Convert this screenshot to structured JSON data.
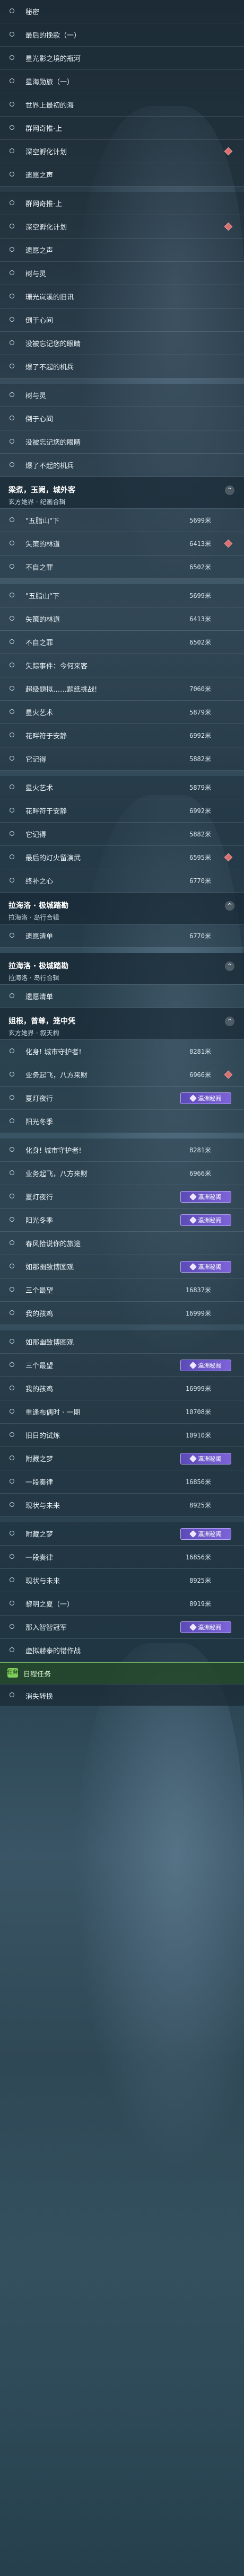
{
  "colors": {
    "accent_badge": "#6b55c8",
    "diamond": "#d87070",
    "bottom_bar": "#7fcf5a"
  },
  "badge_label": "瀛洲秘阁",
  "blocks": [
    {
      "kind": "rows",
      "rows": [
        {
          "label": "秘密"
        },
        {
          "label": "最后的挽歌（一）"
        },
        {
          "label": "星光影之境的瓶河"
        },
        {
          "label": "星海勋旅（一）"
        },
        {
          "label": "世界上最初的海"
        },
        {
          "label": "群网奇推·上"
        },
        {
          "label": "深空孵化计划",
          "diamond": true
        },
        {
          "label": "遗愿之声"
        }
      ]
    },
    {
      "kind": "gap"
    },
    {
      "kind": "rows",
      "rows": [
        {
          "label": "群网奇推·上"
        },
        {
          "label": "深空孵化计划",
          "diamond": true
        },
        {
          "label": "遗愿之声"
        },
        {
          "label": "树与灵"
        },
        {
          "label": "珊光岚溪的旧讯"
        },
        {
          "label": "倒于心间"
        },
        {
          "label": "没被忘记您的眼睛"
        },
        {
          "label": "爆了不起的机兵"
        }
      ]
    },
    {
      "kind": "gap"
    },
    {
      "kind": "rows",
      "rows": [
        {
          "label": "树与灵"
        },
        {
          "label": "倒于心间"
        },
        {
          "label": "没被忘记您的眼睛"
        },
        {
          "label": "爆了不起的机兵"
        }
      ]
    },
    {
      "kind": "group",
      "title": "梁煮，玉阙，城外客",
      "subtitle": "玄方她界 · 纪画合辑"
    },
    {
      "kind": "rows",
      "rows": [
        {
          "label": "\"五脂山\"下",
          "value": "5699米"
        },
        {
          "label": "失策的林道",
          "value": "6413米",
          "diamond": true
        },
        {
          "label": "不自之罪",
          "value": "6502米"
        }
      ]
    },
    {
      "kind": "gap"
    },
    {
      "kind": "rows",
      "rows": [
        {
          "label": "\"五脂山\"下",
          "value": "5699米"
        },
        {
          "label": "失策的林道",
          "value": "6413米"
        },
        {
          "label": "不自之罪",
          "value": "6502米"
        },
        {
          "label": "失踪事件：今何来客",
          "value": ""
        },
        {
          "label": "超级题拟……题纸挑战!",
          "value": "7060米"
        },
        {
          "label": "星火艺术",
          "value": "5879米"
        },
        {
          "label": "花畔符于安静",
          "value": "6992米"
        },
        {
          "label": "它记得",
          "value": "5882米"
        }
      ]
    },
    {
      "kind": "gap"
    },
    {
      "kind": "rows",
      "rows": [
        {
          "label": "星火艺术",
          "value": "5879米"
        },
        {
          "label": "花畔符于安静",
          "value": "6992米"
        },
        {
          "label": "它记得",
          "value": "5882米"
        },
        {
          "label": "最后的灯火留演武",
          "value": "6595米",
          "diamond": true
        },
        {
          "label": "终补之心",
          "value": "6770米"
        }
      ]
    },
    {
      "kind": "group",
      "title": "拉海洛 · 极城踏勘",
      "subtitle": "拉海洛 · 岛行合辑"
    },
    {
      "kind": "rows",
      "rows": [
        {
          "label": "遗愿清单",
          "value": "6770米"
        }
      ]
    },
    {
      "kind": "gap"
    },
    {
      "kind": "group",
      "title": "拉海洛 · 极城踏勘",
      "subtitle": "拉海洛 · 岛行合辑"
    },
    {
      "kind": "rows",
      "rows": [
        {
          "label": "遗愿清单"
        }
      ]
    },
    {
      "kind": "group",
      "title": "姐根，曾尊，笼中凭",
      "subtitle": "玄方她界 · 叙天构"
    },
    {
      "kind": "rows",
      "rows": [
        {
          "label": "化身! 城市守护者!",
          "value": "8281米"
        },
        {
          "label": "业务起飞，八方来财",
          "value": "6966米",
          "diamond": true
        },
        {
          "label": "夏灯夜行",
          "value": "8037米",
          "badge": true
        },
        {
          "label": "阳光冬季",
          "value": ""
        }
      ]
    },
    {
      "kind": "gap"
    },
    {
      "kind": "rows",
      "rows": [
        {
          "label": "化身! 城市守护者!",
          "value": "8281米"
        },
        {
          "label": "业务起飞，八方来财",
          "value": "6966米"
        },
        {
          "label": "夏灯夜行",
          "value": "8037米",
          "badge": true
        },
        {
          "label": "阳光冬季",
          "value": "",
          "badge": true
        },
        {
          "label": "春风拾说你的旅途",
          "value": ""
        },
        {
          "label": "如那幽致博图观",
          "value": "",
          "badge": true
        },
        {
          "label": "三个最望",
          "value": "16837米"
        },
        {
          "label": "我的孩鸡",
          "value": "16999米"
        }
      ]
    },
    {
      "kind": "gap"
    },
    {
      "kind": "rows",
      "rows": [
        {
          "label": "如那幽致博图观",
          "value": ""
        },
        {
          "label": "三个最望",
          "value": "16837米",
          "badge": true
        },
        {
          "label": "我的孩鸡",
          "value": "16999米"
        },
        {
          "label": "重逢布偶时 · 一期",
          "value": "10708米"
        },
        {
          "label": "旧日的试炼",
          "value": "10910米"
        },
        {
          "label": "附藏之梦",
          "value": "",
          "badge": true
        },
        {
          "label": "一段奏律",
          "value": "16856米"
        },
        {
          "label": "现状与未来",
          "value": "8925米"
        }
      ]
    },
    {
      "kind": "gap"
    },
    {
      "kind": "rows",
      "rows": [
        {
          "label": "附藏之梦",
          "value": "",
          "badge": true
        },
        {
          "label": "一段奏律",
          "value": "16856米"
        },
        {
          "label": "现状与未来",
          "value": "8925米"
        },
        {
          "label": "黎明之夏（一）",
          "value": "8919米"
        },
        {
          "label": "那入智智冠军",
          "value": "",
          "badge": true
        },
        {
          "label": "虚拟赫泰的错作战",
          "value": ""
        }
      ]
    }
  ],
  "bottom": {
    "icon": "任务",
    "label": "日程任务",
    "extra": "消失转换"
  }
}
